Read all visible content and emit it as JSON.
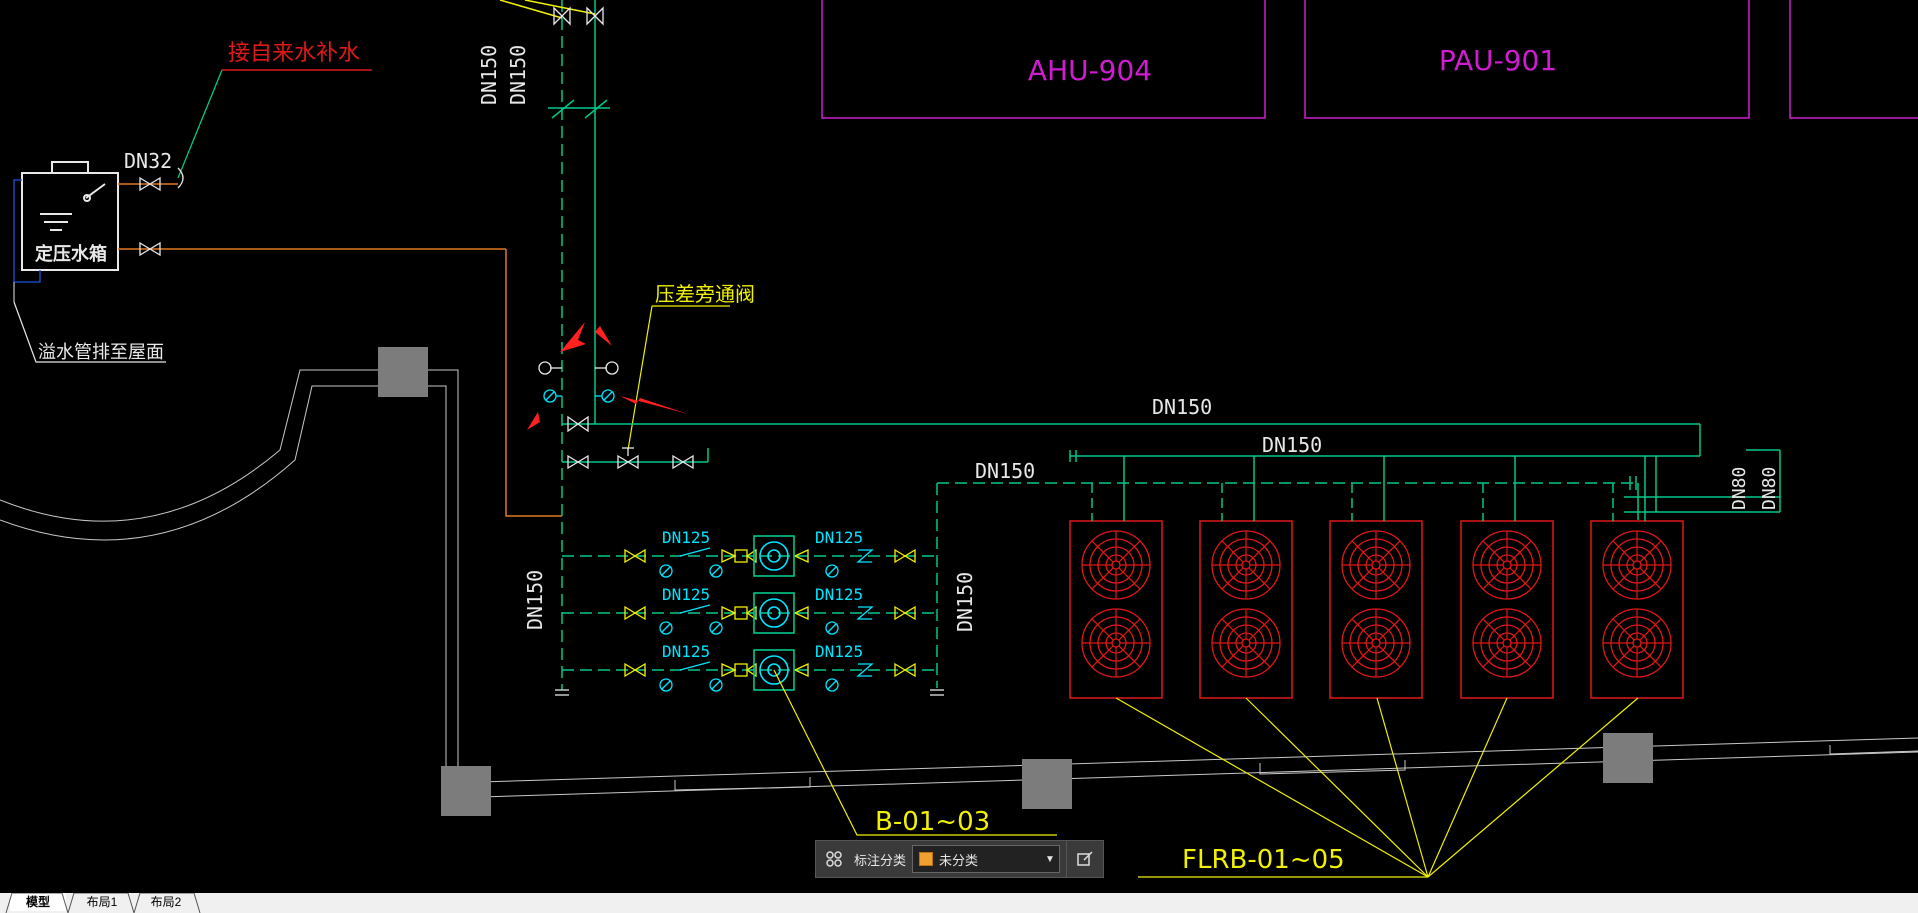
{
  "drawing": {
    "ahu_label": "AHU-904",
    "pau_label": "PAU-901",
    "makeup_water_label": "接自来水补水",
    "dn32_label": "DN32",
    "tank_label": "定压水箱",
    "overflow_label": "溢水管排至屋面",
    "bypass_valve_label": "压差旁通阀",
    "dn150": "DN150",
    "dn125": "DN125",
    "dn80": "DN80",
    "pump_tag": "B-01~03",
    "unit_tag": "FLRB-01~05"
  },
  "colors": {
    "green": "#00c88c",
    "cyan": "#00e5ff",
    "yellow": "#f0f000",
    "red": "#e01818",
    "magenta": "#d01cd0",
    "orange": "#e07820",
    "white": "#e8e8e8",
    "grey": "#808080"
  },
  "toolbar": {
    "grid_icon": "grid-icon",
    "label": "标注分类",
    "selected": "未分类",
    "dropdown_icon": "chevron-down-icon",
    "edit_icon": "edit-icon"
  },
  "tabs": [
    "模型",
    "布局1",
    "布局2"
  ]
}
